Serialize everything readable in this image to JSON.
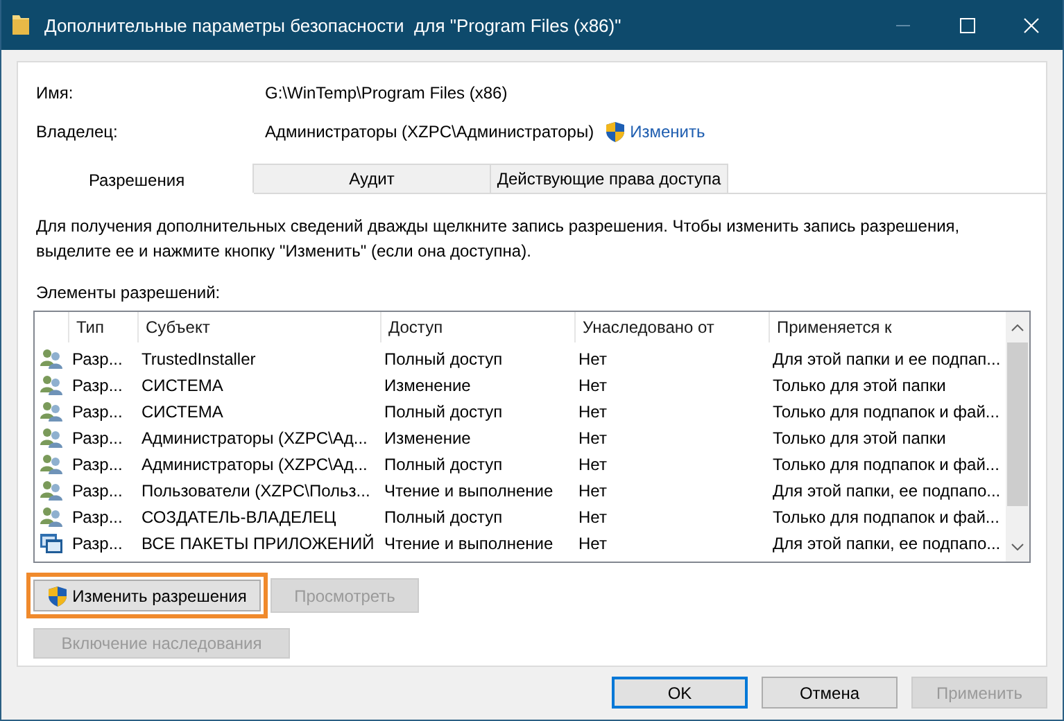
{
  "window": {
    "title": "Дополнительные параметры безопасности  для \"Program Files (x86)\""
  },
  "name": {
    "label": "Имя:",
    "value": "G:\\WinTemp\\Program Files (x86)"
  },
  "owner": {
    "label": "Владелец:",
    "value": "Администраторы (XZPC\\Администраторы)",
    "link": "Изменить"
  },
  "tabs": [
    {
      "label": "Разрешения",
      "selected": true
    },
    {
      "label": "Аудит",
      "selected": false
    },
    {
      "label": "Действующие права доступа",
      "selected": false
    }
  ],
  "description": "Для получения дополнительных сведений дважды щелкните запись разрешения. Чтобы изменить запись разрешения, выделите ее и нажмите кнопку \"Изменить\" (если она доступна).",
  "list_label": "Элементы разрешений:",
  "table": {
    "columns": [
      "Тип",
      "Субъект",
      "Доступ",
      "Унаследовано от",
      "Применяется к"
    ],
    "rows": [
      {
        "kind": "group",
        "cells": [
          "Разр...",
          "TrustedInstaller",
          "Полный доступ",
          "Нет",
          "Для этой папки и ее подпап..."
        ]
      },
      {
        "kind": "group",
        "cells": [
          "Разр...",
          "СИСТЕМА",
          "Изменение",
          "Нет",
          "Только для этой папки"
        ]
      },
      {
        "kind": "group",
        "cells": [
          "Разр...",
          "СИСТЕМА",
          "Полный доступ",
          "Нет",
          "Только для подпапок и фай..."
        ]
      },
      {
        "kind": "group",
        "cells": [
          "Разр...",
          "Администраторы (XZPC\\Ад...",
          "Изменение",
          "Нет",
          "Только для этой папки"
        ]
      },
      {
        "kind": "group",
        "cells": [
          "Разр...",
          "Администраторы (XZPC\\Ад...",
          "Полный доступ",
          "Нет",
          "Только для подпапок и фай..."
        ]
      },
      {
        "kind": "group",
        "cells": [
          "Разр...",
          "Пользователи (XZPC\\Польз...",
          "Чтение и выполнение",
          "Нет",
          "Для этой папки, ее подпапо..."
        ]
      },
      {
        "kind": "group",
        "cells": [
          "Разр...",
          "СОЗДАТЕЛЬ-ВЛАДЕЛЕЦ",
          "Полный доступ",
          "Нет",
          "Только для подпапок и фай..."
        ]
      },
      {
        "kind": "package",
        "cells": [
          "Разр...",
          "ВСЕ ПАКЕТЫ ПРИЛОЖЕНИЙ",
          "Чтение и выполнение",
          "Нет",
          "Для этой папки, ее подпапо..."
        ]
      }
    ]
  },
  "entry_buttons": [
    {
      "label": "Изменить разрешения",
      "kind": "uac",
      "disabled": false,
      "highlighted": true
    },
    {
      "label": "Просмотреть",
      "kind": "plain",
      "disabled": true,
      "highlighted": false
    }
  ],
  "inheritance_button": {
    "label": "Включение наследования",
    "disabled": true
  },
  "dialog_buttons": [
    {
      "label": "OK",
      "disabled": false,
      "default": true
    },
    {
      "label": "Отмена",
      "disabled": false,
      "default": false
    },
    {
      "label": "Применить",
      "disabled": true,
      "default": false
    }
  ]
}
